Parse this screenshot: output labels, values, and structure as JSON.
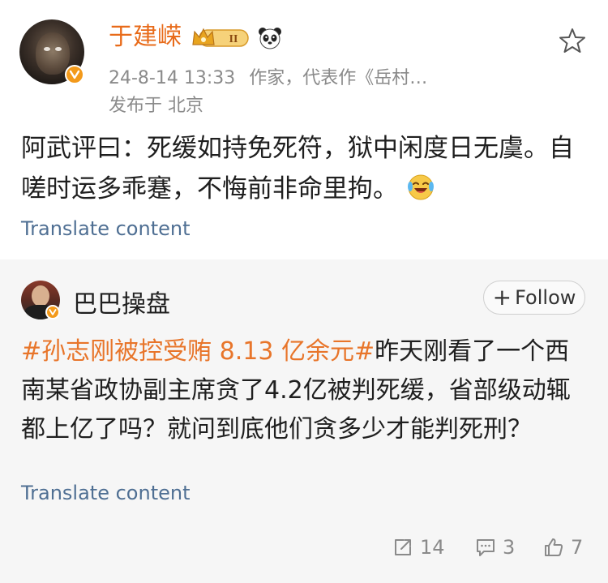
{
  "post": {
    "author": "于建嵘",
    "rank_badge": "II",
    "timestamp": "24-8-14 13:33",
    "description": "作家，代表作《岳村…",
    "location": "发布于 北京",
    "text": "阿武评曰：死缓如持免死符，狱中闲度日无虞。自嗟时运多乖蹇，不悔前非命里拘。",
    "emoji": "laughing-crying-emoji",
    "translate": "Translate content"
  },
  "repost": {
    "author": "巴巴操盘",
    "follow_label": "Follow",
    "hashtag": "#孙志刚被控受贿 8.13 亿余元#",
    "text": "昨天刚看了一个西南某省政协副主席贪了4.2亿被判死缓，省部级动辄都上亿了吗？就问到底他们贪多少才能判死刑？",
    "translate": "Translate content",
    "shares": "14",
    "comments": "3",
    "likes": "7"
  },
  "colors": {
    "author_orange": "#e86b1a",
    "hashtag_orange": "#e8752a",
    "link_blue": "#4f6f93",
    "verified_orange": "#f39a1b"
  }
}
